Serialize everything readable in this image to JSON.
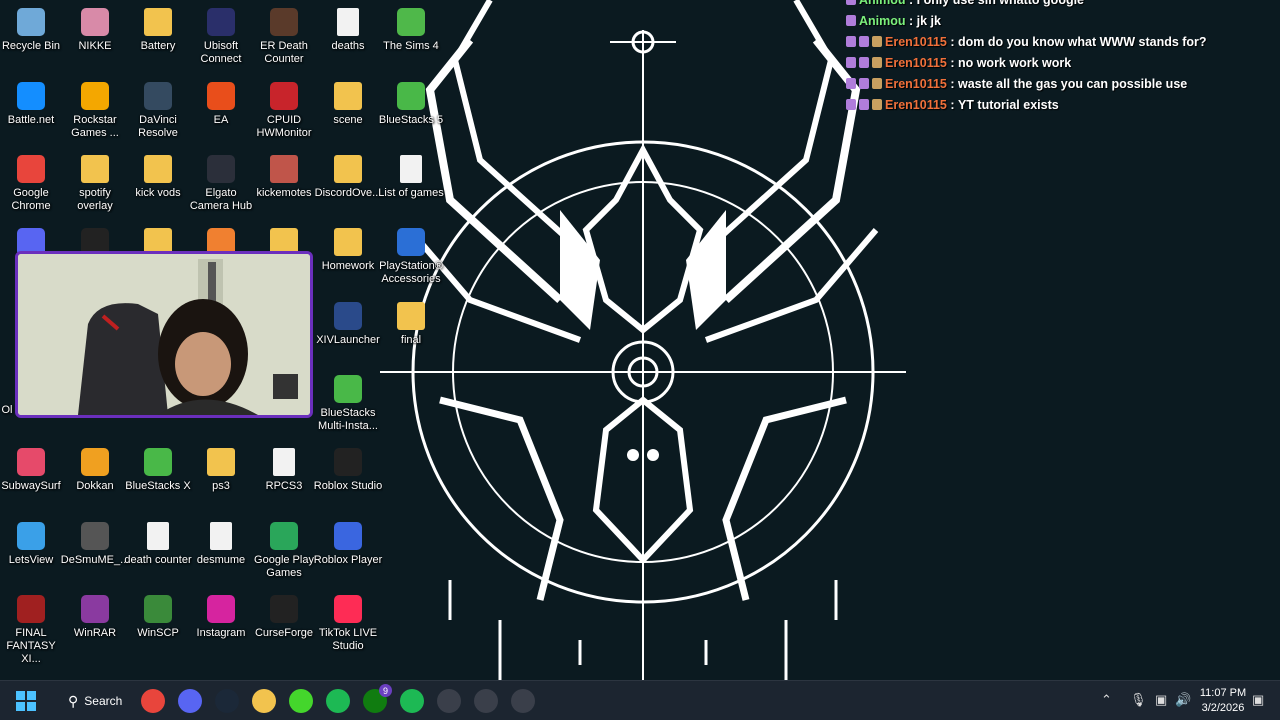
{
  "desktop": {
    "icons": [
      {
        "label": "Recycle Bin",
        "icon": "recycle-bin-icon",
        "color": "#6fa9d8"
      },
      {
        "label": "NIKKE",
        "icon": "nikke-icon",
        "color": "#d88aa8"
      },
      {
        "label": "Battery",
        "icon": "folder-icon",
        "color": "#f2c34e"
      },
      {
        "label": "Ubisoft Connect",
        "icon": "ubisoft-icon",
        "color": "#2a2f6a"
      },
      {
        "label": "ER Death Counter",
        "icon": "elden-ring-icon",
        "color": "#5a3a2a"
      },
      {
        "label": "deaths",
        "icon": "text-file-icon",
        "color": "#f2f2f2"
      },
      {
        "label": "The Sims 4",
        "icon": "sims-icon",
        "color": "#4fb84a"
      },
      {
        "label": "Battle.net",
        "icon": "battlenet-icon",
        "color": "#148eff"
      },
      {
        "label": "Rockstar Games ...",
        "icon": "rockstar-icon",
        "color": "#f4a700"
      },
      {
        "label": "DaVinci Resolve",
        "icon": "davinci-icon",
        "color": "#344a60"
      },
      {
        "label": "EA",
        "icon": "ea-icon",
        "color": "#e94e1b"
      },
      {
        "label": "CPUID HWMonitor",
        "icon": "hwmonitor-icon",
        "color": "#c8242b"
      },
      {
        "label": "scene",
        "icon": "folder-icon",
        "color": "#f2c34e"
      },
      {
        "label": "BlueStacks 5",
        "icon": "bluestacks-icon",
        "color": "#49b848"
      },
      {
        "label": "Google Chrome",
        "icon": "chrome-icon",
        "color": "#e8453c"
      },
      {
        "label": "spotify overlay",
        "icon": "folder-icon",
        "color": "#f2c34e"
      },
      {
        "label": "kick vods",
        "icon": "folder-icon",
        "color": "#f2c34e"
      },
      {
        "label": "Elgato Camera Hub",
        "icon": "elgato-icon",
        "color": "#2b2f3a"
      },
      {
        "label": "kickemotes",
        "icon": "folder-icon",
        "color": "#c0554a"
      },
      {
        "label": "DiscordOve...",
        "icon": "folder-icon",
        "color": "#f2c34e"
      },
      {
        "label": "List of games",
        "icon": "text-file-icon",
        "color": "#f2f2f2"
      },
      {
        "label": "",
        "icon": "discord-icon",
        "color": "#5865f2"
      },
      {
        "label": "",
        "icon": "epic-games-icon",
        "color": "#222"
      },
      {
        "label": "",
        "icon": "folder-icon",
        "color": "#f2c34e"
      },
      {
        "label": "",
        "icon": "app-icon",
        "color": "#f08030"
      },
      {
        "label": "",
        "icon": "folder-icon",
        "color": "#f2c34e"
      },
      {
        "label": "Homework",
        "icon": "folder-icon",
        "color": "#f2c34e"
      },
      {
        "label": "PlayStation® Accessories",
        "icon": "playstation-icon",
        "color": "#2b6fd6"
      },
      {
        "label": "XIVLauncher",
        "icon": "xivlauncher-icon",
        "color": "#2a4a8a"
      },
      {
        "label": "final",
        "icon": "folder-icon",
        "color": "#f2c34e"
      },
      {
        "label": "BlueStacks Multi-Insta...",
        "icon": "bluestacks-icon",
        "color": "#49b848"
      },
      {
        "label": "SubwaySurf",
        "icon": "subway-surf-icon",
        "color": "#e64a6a"
      },
      {
        "label": "Dokkan",
        "icon": "dokkan-icon",
        "color": "#f0a020"
      },
      {
        "label": "BlueStacks X",
        "icon": "bluestacks-icon",
        "color": "#49b848"
      },
      {
        "label": "ps3",
        "icon": "folder-icon",
        "color": "#f2c34e"
      },
      {
        "label": "RPCS3",
        "icon": "text-file-icon",
        "color": "#f2f2f2"
      },
      {
        "label": "Roblox Studio",
        "icon": "roblox-studio-icon",
        "color": "#222"
      },
      {
        "label": "LetsView",
        "icon": "letsview-icon",
        "color": "#3aa0e8"
      },
      {
        "label": "DeSmuME_...",
        "icon": "desmume-icon",
        "color": "#555"
      },
      {
        "label": "death counter",
        "icon": "text-file-icon",
        "color": "#f2f2f2"
      },
      {
        "label": "desmume",
        "icon": "text-file-icon",
        "color": "#f2f2f2"
      },
      {
        "label": "Google Play Games",
        "icon": "play-games-icon",
        "color": "#2aa65a"
      },
      {
        "label": "Roblox Player",
        "icon": "roblox-icon",
        "color": "#3a66e0"
      },
      {
        "label": "FINAL FANTASY XI...",
        "icon": "ffxiv-icon",
        "color": "#a02020"
      },
      {
        "label": "WinRAR",
        "icon": "winrar-icon",
        "color": "#8a3aa0"
      },
      {
        "label": "WinSCP",
        "icon": "winscp-icon",
        "color": "#3a8a3a"
      },
      {
        "label": "Instagram",
        "icon": "instagram-icon",
        "color": "#d6249f"
      },
      {
        "label": "CurseForge",
        "icon": "curseforge-icon",
        "color": "#222"
      },
      {
        "label": "TikTok LIVE Studio",
        "icon": "tiktok-icon",
        "color": "#fe2c55"
      }
    ],
    "partial_label": "Ol"
  },
  "chat": {
    "messages": [
      {
        "user": "Animou",
        "text": "I only use sin whatto google",
        "color": "#7cf07c"
      },
      {
        "user": "Animou",
        "text": "jk jk",
        "color": "#7cf07c"
      },
      {
        "user": "Eren10115",
        "text": "dom do you know what WWW stands for?",
        "color": "#f0703a"
      },
      {
        "user": "Eren10115",
        "text": "no work work work",
        "color": "#f0703a"
      },
      {
        "user": "Eren10115",
        "text": "waste all the gas you can possible use",
        "color": "#f0703a"
      },
      {
        "user": "Eren10115",
        "text": "YT tutorial exists",
        "color": "#f0703a"
      }
    ],
    "separator": " : "
  },
  "taskbar": {
    "search_label": "Search",
    "apps": [
      "chrome-icon",
      "discord-icon",
      "steam-icon",
      "file-explorer-icon",
      "razer-icon",
      "spotify-alt-icon",
      "xbox-icon",
      "spotify-icon",
      "elgato-icon",
      "calculator-icon",
      "obs-icon"
    ],
    "xbox_badge": "9",
    "time": "11:07 PM",
    "date": "3/2/2026"
  }
}
